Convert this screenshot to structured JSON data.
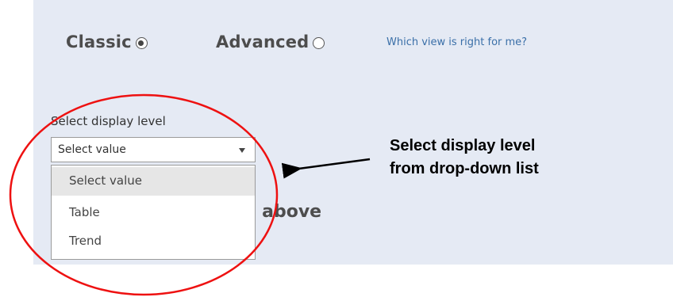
{
  "view_toggle": {
    "classic_label": "Classic",
    "classic_selected": true,
    "advanced_label": "Advanced",
    "advanced_selected": false,
    "help_link": "Which view is right for me?"
  },
  "display_level": {
    "label": "Select display level",
    "selected_value": "Select value",
    "options": [
      "Select value",
      "Table",
      "Trend"
    ],
    "highlighted_option": "Select value"
  },
  "background_text": "el above",
  "annotation": {
    "line1": "Select display level",
    "line2": "from drop-down list",
    "circle_color": "#ee1111",
    "arrow_color": "#000000"
  },
  "colors": {
    "panel_background": "#e5eaf4",
    "link": "#3a6fa8",
    "highlight_row": "#e6e6e6"
  },
  "icons": {
    "caret": "chevron-down-icon",
    "radio_on": "radio-checked-icon",
    "radio_off": "radio-unchecked-icon"
  }
}
